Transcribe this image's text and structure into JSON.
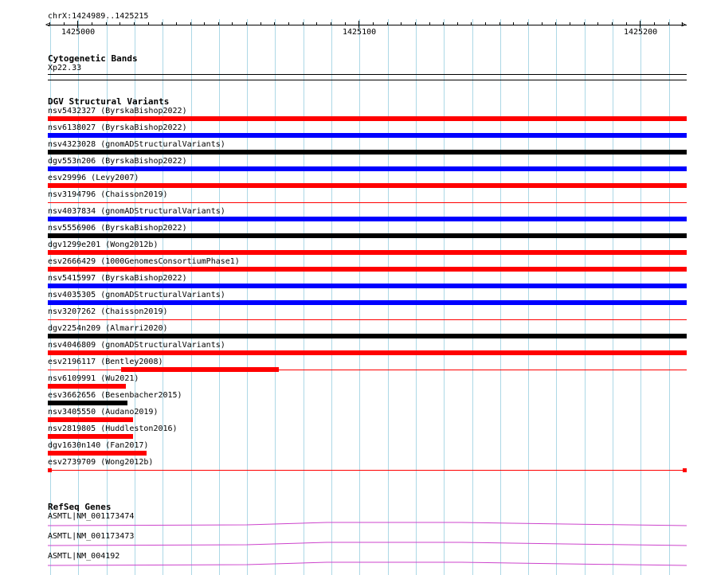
{
  "ruler": {
    "region": "chrX:1424989..1425215",
    "ticks": [
      "1425000",
      "1425100",
      "1425200"
    ]
  },
  "cytoband": {
    "title": "Cytogenetic Bands",
    "band": "Xp22.33"
  },
  "dgv": {
    "title": "DGV Structural Variants",
    "colors": {
      "gain": "#0000ff",
      "loss": "#ff0000",
      "both": "#000000"
    },
    "items": [
      {
        "label": "nsv5432327 (ByrskaBishop2022)",
        "color": "#ff0000",
        "style": "thick",
        "start": 0.0,
        "end": 1.0
      },
      {
        "label": "nsv6138027 (ByrskaBishop2022)",
        "color": "#0000ff",
        "style": "thick",
        "start": 0.0,
        "end": 1.0
      },
      {
        "label": "nsv4323028 (gnomADStructuralVariants)",
        "color": "#000000",
        "style": "thick",
        "start": 0.0,
        "end": 1.0
      },
      {
        "label": "dgv553n206 (ByrskaBishop2022)",
        "color": "#0000ff",
        "style": "thick",
        "start": 0.0,
        "end": 1.0
      },
      {
        "label": "esv29996 (Levy2007)",
        "color": "#ff0000",
        "style": "thick",
        "start": 0.0,
        "end": 1.0
      },
      {
        "label": "nsv3194796 (Chaisson2019)",
        "color": "#ff0000",
        "style": "thin",
        "start": 0.0,
        "end": 1.0
      },
      {
        "label": "nsv4037834 (gnomADStructuralVariants)",
        "color": "#0000ff",
        "style": "thick",
        "start": 0.0,
        "end": 1.0
      },
      {
        "label": "nsv5556906 (ByrskaBishop2022)",
        "color": "#000000",
        "style": "thick",
        "start": 0.0,
        "end": 1.0
      },
      {
        "label": "dgv1299e201 (Wong2012b)",
        "color": "#ff0000",
        "style": "thick",
        "start": 0.0,
        "end": 1.0
      },
      {
        "label": "esv2666429 (1000GenomesConsortiumPhase1)",
        "color": "#ff0000",
        "style": "thick",
        "start": 0.0,
        "end": 1.0
      },
      {
        "label": "nsv5415997 (ByrskaBishop2022)",
        "color": "#0000ff",
        "style": "thick",
        "start": 0.0,
        "end": 1.0
      },
      {
        "label": "nsv4035305 (gnomADStructuralVariants)",
        "color": "#0000ff",
        "style": "thick",
        "start": 0.0,
        "end": 1.0
      },
      {
        "label": "nsv3207262 (Chaisson2019)",
        "color": "#ff0000",
        "style": "thin",
        "start": 0.0,
        "end": 1.0
      },
      {
        "label": "dgv2254n209 (Almarri2020)",
        "color": "#000000",
        "style": "thick",
        "start": 0.0,
        "end": 1.0
      },
      {
        "label": "nsv4046809 (gnomADStructuralVariants)",
        "color": "#ff0000",
        "style": "thick",
        "start": 0.0,
        "end": 1.0
      },
      {
        "label": "esv2196117 (Bentley2008)",
        "color": "#ff0000",
        "style": "partial",
        "start": 0.0,
        "end": 1.0,
        "thickStart": 0.115,
        "thickEnd": 0.361
      },
      {
        "label": "nsv6109991 (Wu2021)",
        "color": "#ff0000",
        "style": "thick",
        "start": 0.0,
        "end": 0.122
      },
      {
        "label": "esv3662656 (Besenbacher2015)",
        "color": "#000000",
        "style": "thick",
        "start": 0.0,
        "end": 0.125
      },
      {
        "label": "nsv3405550 (Audano2019)",
        "color": "#ff0000",
        "style": "thick",
        "start": 0.0,
        "end": 0.133
      },
      {
        "label": "nsv2819805 (Huddleston2016)",
        "color": "#ff0000",
        "style": "thick",
        "start": 0.0,
        "end": 0.133
      },
      {
        "label": "dgv1630n140 (Fan2017)",
        "color": "#ff0000",
        "style": "thick",
        "start": 0.0,
        "end": 0.155
      },
      {
        "label": "esv2739709 (Wong2012b)",
        "color": "#ff0000",
        "style": "capped",
        "start": 0.0,
        "end": 1.0
      }
    ]
  },
  "refseq": {
    "title": "RefSeq Genes",
    "color": "#cc44cc",
    "items": [
      {
        "label": "ASMTL|NM_001173474"
      },
      {
        "label": "ASMTL|NM_001173473"
      },
      {
        "label": "ASMTL|NM_004192"
      }
    ]
  }
}
